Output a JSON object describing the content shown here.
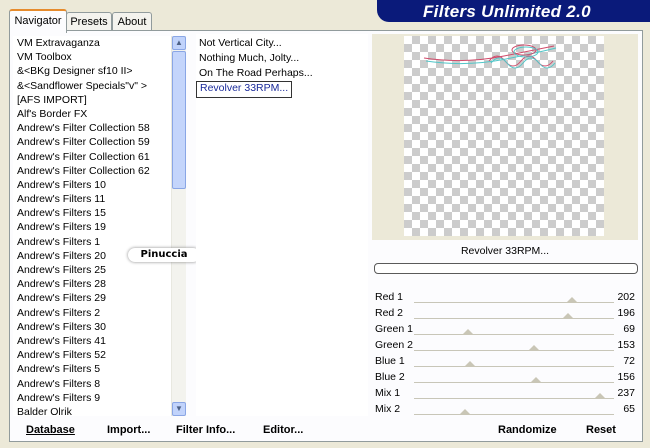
{
  "tabs": [
    {
      "label": "Navigator",
      "active": true
    },
    {
      "label": "Presets",
      "active": false
    },
    {
      "label": "About",
      "active": false
    }
  ],
  "title": "Filters Unlimited 2.0",
  "categories": [
    "VM Extravaganza",
    "VM Toolbox",
    "&<BKg Designer sf10 II>",
    "&<Sandflower Specials\"v\" >",
    "[AFS IMPORT]",
    "Alf's Border FX",
    "Andrew's Filter Collection 58",
    "Andrew's Filter Collection 59",
    "Andrew's Filter Collection 61",
    "Andrew's Filter Collection 62",
    "Andrew's Filters 10",
    "Andrew's Filters 11",
    "Andrew's Filters 15",
    "Andrew's Filters 19",
    "Andrew's Filters 1",
    "Andrew's Filters 20",
    "Andrew's Filters 25",
    "Andrew's Filters 28",
    "Andrew's Filters 29",
    "Andrew's Filters 2",
    "Andrew's Filters 30",
    "Andrew's Filters 41",
    "Andrew's Filters 52",
    "Andrew's Filters 5",
    "Andrew's Filters 8",
    "Andrew's Filters 9",
    "Balder Olrik"
  ],
  "selected_category": "Andrew's Filters 20",
  "filters": [
    "Not Vertical City...",
    "Nothing Much, Jolty...",
    "On The Road Perhaps...",
    "Revolver 33RPM..."
  ],
  "selected_filter": "Revolver 33RPM...",
  "watermark": "Pinuccia",
  "current_filter_name": "Revolver 33RPM...",
  "sliders": [
    {
      "label": "Red 1",
      "value": "202",
      "level": 202
    },
    {
      "label": "Red 2",
      "value": "196",
      "level": 196
    },
    {
      "label": "Green 1",
      "value": "69",
      "level": 69
    },
    {
      "label": "Green 2",
      "value": "153",
      "level": 153
    },
    {
      "label": "Blue 1",
      "value": "72",
      "level": 72
    },
    {
      "label": "Blue 2",
      "value": "156",
      "level": 156
    },
    {
      "label": "Mix 1",
      "value": "237",
      "level": 237
    },
    {
      "label": "Mix 2",
      "value": "65",
      "level": 65
    }
  ],
  "buttons": {
    "database": "Database",
    "import": "Import...",
    "filter_info": "Filter Info...",
    "editor": "Editor...",
    "randomize": "Randomize",
    "reset": "Reset"
  },
  "scroll_arrows": {
    "up": "▲",
    "down": "▼"
  }
}
